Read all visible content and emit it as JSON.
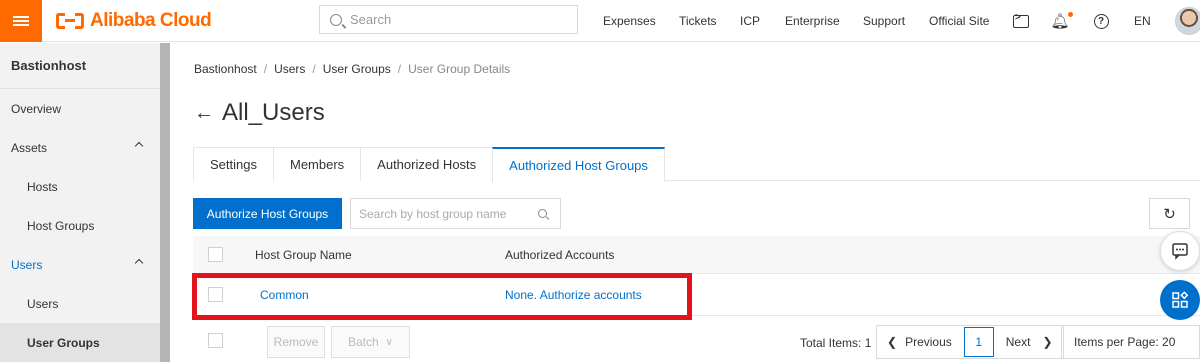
{
  "brand": {
    "logo_text": "Alibaba Cloud",
    "accent_color": "#ff6a00",
    "primary_color": "#0070cc"
  },
  "topbar": {
    "search_placeholder": "Search",
    "nav": [
      "Expenses",
      "Tickets",
      "ICP",
      "Enterprise",
      "Support",
      "Official Site"
    ],
    "language": "EN",
    "icons": [
      "menu-icon",
      "terminal-icon",
      "bell-icon",
      "help-icon",
      "avatar"
    ]
  },
  "sidebar": {
    "title": "Bastionhost",
    "items": [
      {
        "label": "Overview"
      },
      {
        "label": "Assets"
      },
      {
        "label": "Hosts"
      },
      {
        "label": "Host Groups"
      },
      {
        "label": "Users"
      },
      {
        "label": "Users"
      },
      {
        "label": "User Groups"
      }
    ]
  },
  "breadcrumb": [
    "Bastionhost",
    "Users",
    "User Groups",
    "User Group Details"
  ],
  "page": {
    "title": "All_Users"
  },
  "tabs": [
    "Settings",
    "Members",
    "Authorized Hosts",
    "Authorized Host Groups"
  ],
  "toolbar": {
    "authorize_label": "Authorize Host Groups",
    "search_placeholder": "Search by host group name"
  },
  "table": {
    "columns": [
      "Host Group Name",
      "Authorized Accounts"
    ],
    "rows": [
      {
        "name": "Common",
        "accounts": "None. Authorize accounts"
      }
    ]
  },
  "footer": {
    "remove_label": "Remove",
    "batch_label": "Batch",
    "total": "Total Items: 1",
    "prev_label": "Previous",
    "page": "1",
    "next_label": "Next",
    "per_page": "Items per Page: 20"
  }
}
